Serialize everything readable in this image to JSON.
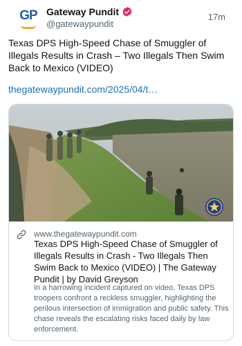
{
  "post": {
    "author_name": "Gateway Pundit",
    "handle": "@gatewaypundit",
    "time": "17m",
    "text": "Texas DPS High-Speed Chase of Smuggler of Illegals Results in Crash – Two Illegals Then Swim Back to Mexico (VIDEO)",
    "link": "thegatewaypundit.com/2025/04/t…",
    "avatar": {
      "letters": "GP"
    }
  },
  "card": {
    "domain": "www.thegatewaypundit.com",
    "title": "Texas DPS High-Speed Chase of Smuggler of Illegals Results in Crash - Two Illegals Then Swim Back to Mexico (VIDEO) | The Gateway Pundit | by David Greyson",
    "description": "In a harrowing incident captured on video, Texas DPS troopers confront a reckless smuggler, highlighting the perilous intersection of immigration and public safety. This chase reveals the escalating risks faced daily by law enforcement."
  },
  "icons": {
    "verified": "verified-badge-icon",
    "link": "link-icon",
    "seal": "texas-dps-seal-icon"
  },
  "colors": {
    "link": "#1d6fb8",
    "badge": "#e0245e",
    "muted": "#536471",
    "text": "#0f1419"
  }
}
